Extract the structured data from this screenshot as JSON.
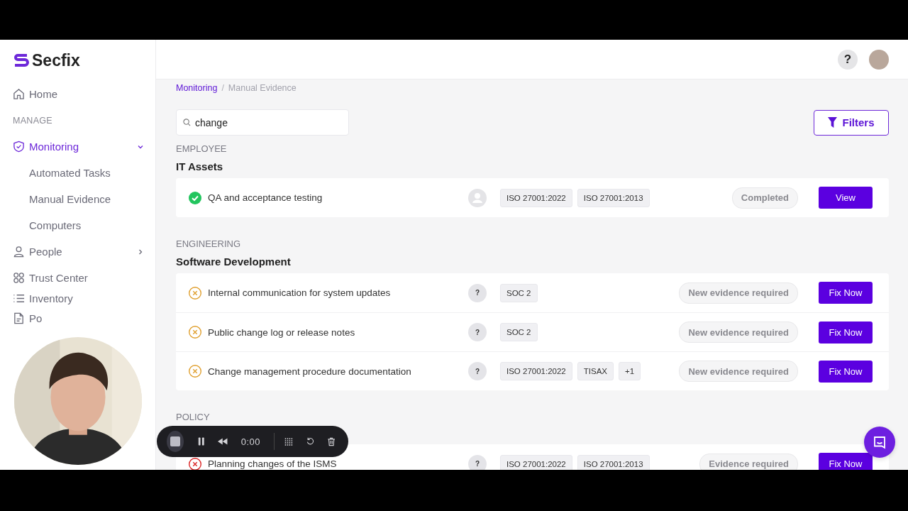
{
  "brand": {
    "name": "Secfix"
  },
  "sidebar": {
    "items": [
      {
        "kind": "link",
        "label": "Home",
        "selected": false
      },
      {
        "kind": "heading",
        "label": "MANAGE"
      },
      {
        "kind": "link",
        "label": "Monitoring",
        "selected": true,
        "expanded": true,
        "children": [
          {
            "label": "Automated Tasks",
            "selected": false
          },
          {
            "label": "Manual Evidence",
            "selected": false
          },
          {
            "label": "Computers",
            "selected": false
          }
        ]
      },
      {
        "kind": "link",
        "label": "People",
        "selected": false,
        "expanded": false
      },
      {
        "kind": "link",
        "label": "Trust Center",
        "selected": false
      },
      {
        "kind": "link",
        "label": "Inventory",
        "selected": false
      },
      {
        "kind": "link",
        "label": "Po",
        "selected": false
      }
    ]
  },
  "header": {
    "help_label": "?"
  },
  "breadcrumb": {
    "separator": "/",
    "items": [
      {
        "label": "Monitoring",
        "link": true
      },
      {
        "label": "Manual Evidence",
        "link": false
      }
    ]
  },
  "search": {
    "value": "change"
  },
  "filters_button": {
    "label": "Filters"
  },
  "sections": [
    {
      "category": "EMPLOYEE",
      "title": "IT Assets",
      "rows": [
        {
          "kind": "done",
          "name": "QA and acceptance testing",
          "assignee": {
            "kind": "avatar"
          },
          "tags": [
            "ISO 27001:2022",
            "ISO 27001:2013"
          ],
          "state": "Completed",
          "action": "View"
        }
      ]
    },
    {
      "category": "ENGINEERING",
      "title": "Software Development",
      "rows": [
        {
          "kind": "missing",
          "name": "Internal communication for system updates",
          "assignee": {
            "kind": "unknown",
            "label": "?"
          },
          "tags": [
            "SOC 2"
          ],
          "state": "New evidence required",
          "action": "Fix Now"
        },
        {
          "kind": "missing",
          "name": "Public change log or release notes",
          "assignee": {
            "kind": "unknown",
            "label": "?"
          },
          "tags": [
            "SOC 2"
          ],
          "state": "New evidence required",
          "action": "Fix Now"
        },
        {
          "kind": "missing",
          "name": "Change management procedure documentation",
          "assignee": {
            "kind": "unknown",
            "label": "?"
          },
          "tags": [
            "ISO 27001:2022",
            "TISAX",
            "+1"
          ],
          "state": "New evidence required",
          "action": "Fix Now"
        }
      ]
    },
    {
      "category": "POLICY",
      "rows": [
        {
          "kind": "failed",
          "name": "Planning changes of the ISMS",
          "assignee": {
            "kind": "unknown",
            "label": "?"
          },
          "tags": [
            "ISO 27001:2022",
            "ISO 27001:2013"
          ],
          "state": "Evidence required",
          "action": "Fix Now"
        }
      ]
    }
  ],
  "recorder": {
    "time": "0:00"
  }
}
